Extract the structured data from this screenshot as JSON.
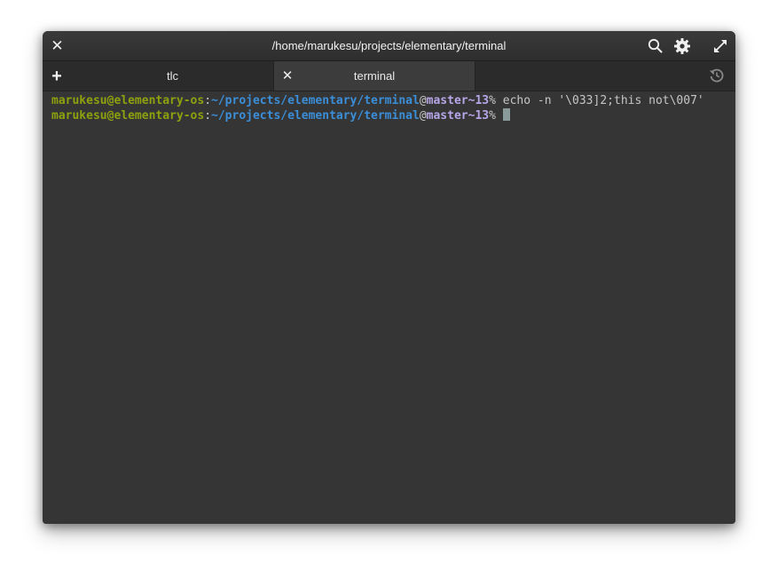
{
  "window": {
    "title": "/home/marukesu/projects/elementary/terminal",
    "close_glyph": "✕"
  },
  "header_icons": [
    "search-icon",
    "gear-icon",
    "maximize-icon"
  ],
  "tabs": [
    {
      "label": "tlc",
      "active": false
    },
    {
      "label": "terminal",
      "active": true,
      "close_glyph": "✕"
    }
  ],
  "new_tab_glyph": "+",
  "history_icon": "history-icon",
  "terminal": {
    "lines": [
      {
        "user": "marukesu@elementary-os",
        "colon": ":",
        "path": "~/projects/elementary/terminal",
        "at": "@",
        "branch": "master~13",
        "pct": "%",
        "command": " echo -n '\\033]2;this not\\007'"
      },
      {
        "user": "marukesu@elementary-os",
        "colon": ":",
        "path": "~/projects/elementary/terminal",
        "at": "@",
        "branch": "master~13",
        "pct": "%",
        "command": " "
      }
    ]
  },
  "colors": {
    "user": "#8ea10e",
    "path": "#3b8ed8",
    "branch": "#b7a6e8",
    "background": "#353535",
    "cursor": "#8a9a9a"
  }
}
